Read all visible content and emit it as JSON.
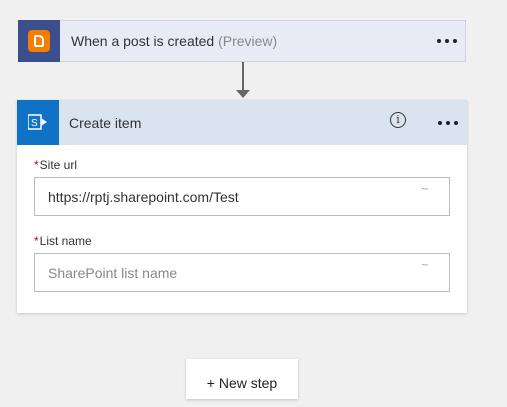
{
  "trigger": {
    "title": "When a post is created",
    "tag": "(Preview)",
    "icon": "blogger-icon",
    "icon_color": "#f57d00",
    "icon_bg": "#3b4f8f"
  },
  "action": {
    "title": "Create item",
    "icon": "sharepoint-icon",
    "icon_bg": "#0f72c6",
    "info_glyph": "i",
    "fields": [
      {
        "label": "Site url",
        "required_mark": "*",
        "value": "https://rptj.sharepoint.com/Test",
        "placeholder": ""
      },
      {
        "label": "List name",
        "required_mark": "*",
        "value": "",
        "placeholder": "SharePoint list name"
      }
    ]
  },
  "new_step": {
    "label": "+ New step"
  }
}
